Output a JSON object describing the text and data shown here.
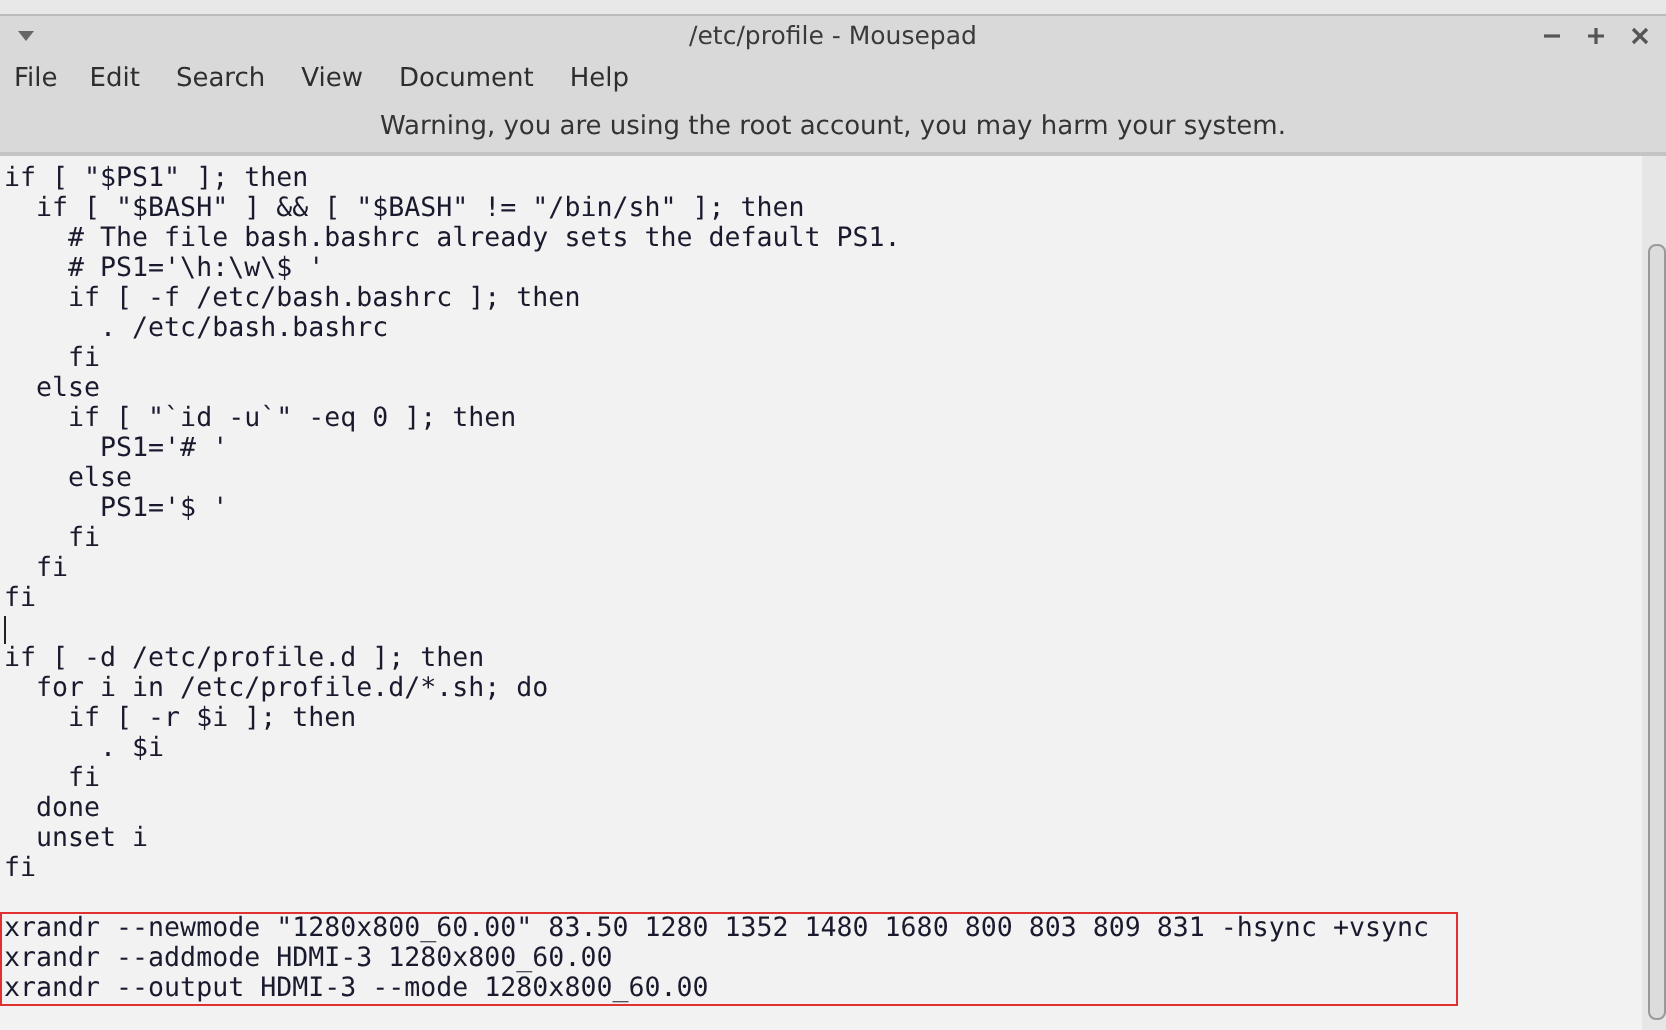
{
  "window": {
    "title": "/etc/profile - Mousepad"
  },
  "menu": [
    "File",
    "Edit",
    "Search",
    "View",
    "Document",
    "Help"
  ],
  "warning": "Warning, you are using the root account, you may harm your system.",
  "editor": {
    "blocks": [
      {
        "highlighted": false,
        "cursor_after": true,
        "lines": [
          "if [ \"$PS1\" ]; then",
          "  if [ \"$BASH\" ] && [ \"$BASH\" != \"/bin/sh\" ]; then",
          "    # The file bash.bashrc already sets the default PS1.",
          "    # PS1='\\h:\\w\\$ '",
          "    if [ -f /etc/bash.bashrc ]; then",
          "      . /etc/bash.bashrc",
          "    fi",
          "  else",
          "    if [ \"`id -u`\" -eq 0 ]; then",
          "      PS1='# '",
          "    else",
          "      PS1='$ '",
          "    fi",
          "  fi",
          "fi"
        ]
      },
      {
        "highlighted": false,
        "cursor_after": false,
        "lines": [
          "if [ -d /etc/profile.d ]; then",
          "  for i in /etc/profile.d/*.sh; do",
          "    if [ -r $i ]; then",
          "      . $i",
          "    fi",
          "  done",
          "  unset i",
          "fi"
        ]
      },
      {
        "highlighted": true,
        "lines": [
          "xrandr --newmode \"1280x800_60.00\" 83.50 1280 1352 1480 1680 800 803 809 831 -hsync +vsync",
          "xrandr --addmode HDMI-3 1280x800_60.00",
          "xrandr --output HDMI-3 --mode 1280x800_60.00"
        ]
      }
    ]
  }
}
